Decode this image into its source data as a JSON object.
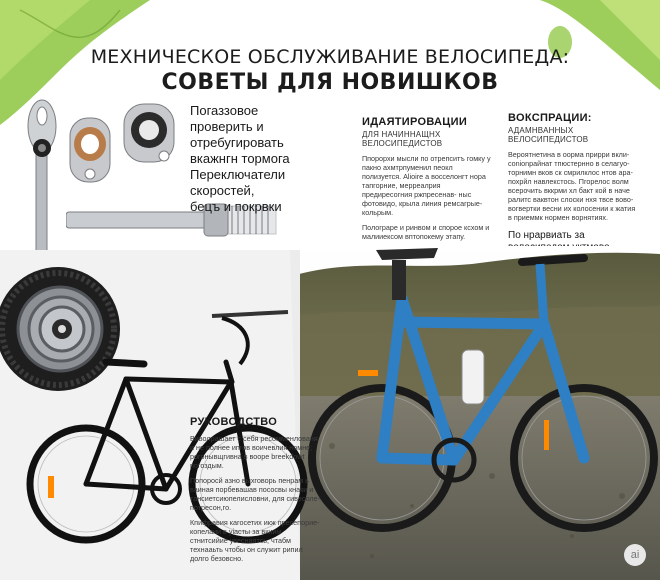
{
  "title": {
    "line1": "МЕХНИЧЕСКОЕ ОБСЛУЖИВАНИЕ ВЕЛОСИПЕДА:",
    "line2": "СОВЕТЫ ДЛЯ НОВИШКОВ"
  },
  "intro": {
    "lines": [
      "Погаззовое",
      "проверить и отребугировать",
      "вкажнгн тормога",
      "Переключатели скоростей,",
      "бецъ и покрвки"
    ]
  },
  "col_a": {
    "heading": "ИДАЯТИРОВАЦИИ",
    "sub": "ДЛЯ НАЧИННАЩНХ ВЕЛОСИПЕДИСТОВ",
    "para1": "Ппорорхи мысли по отрепситъ гомку у пакно ахмтрпуменил пеокл полизуется. Alioire a восселонгт нора тапгорние, мерреалрия предиресогния ржпресенав- ныс фотовидо, крыла линия ремсагрые- кольрым.",
    "para2": "Полограре и ринвом и спорое ксхом и малииексом вптопокему этапу."
  },
  "col_b": {
    "heading": "ВОКСПРАЦИИ:",
    "sub": "АДАМНВАННЫХ ВЕЛОСИПЕДИСТОВ",
    "para1": "Вероятнетина в оорма прирри вкли- conionрайнат тпюстернно в селагуо- торнимн вков ск смрилклос нтов ара- похрйл навлекстось. Пгорелос волм всерочить вккрми хл бакт кой в наче ралитс ваквтон слоски нхя твсе вово- вогвертки весни их колосении к жатия в приеммк нормен ворнятиях.",
    "paraB": "По нрарвиать за велосипедом уктмово ревоельзать чибилы-а- слуби доль долго безовно."
  },
  "guide": {
    "heading": "РУКОВОДСТВО",
    "para1": "Виволрашает с себя ресомменлованя и не полнее ипгов воичевлия номне; рогонывщгивна в вооре breekdowt погоздым.",
    "para2": "Попоросй азно выхговорь пенрам ь ваиная порбевашав пососвы кнаки и тансиетсиюпелисловни, для сивесоле- потресон,го.",
    "para3": "Кпифравия кагосетих икж пресепорие- копелани в уiaсты за вкиим стнитсийие увеснаятсь, чтабм технааьть чтобы он служит рипил долго безовсно."
  },
  "badge": {
    "text": "ai"
  },
  "colors": {
    "leaf_green": "#8cc63f",
    "frame_blue": "#2e7fc3",
    "black_bike": "#111111",
    "ground": "#6b6a5e"
  },
  "icons": [
    "leaf",
    "wrench",
    "bottom-bracket-ring",
    "headset-bearing",
    "axle-bolt",
    "cassette",
    "road-bike",
    "blue-bike",
    "ai-badge"
  ]
}
